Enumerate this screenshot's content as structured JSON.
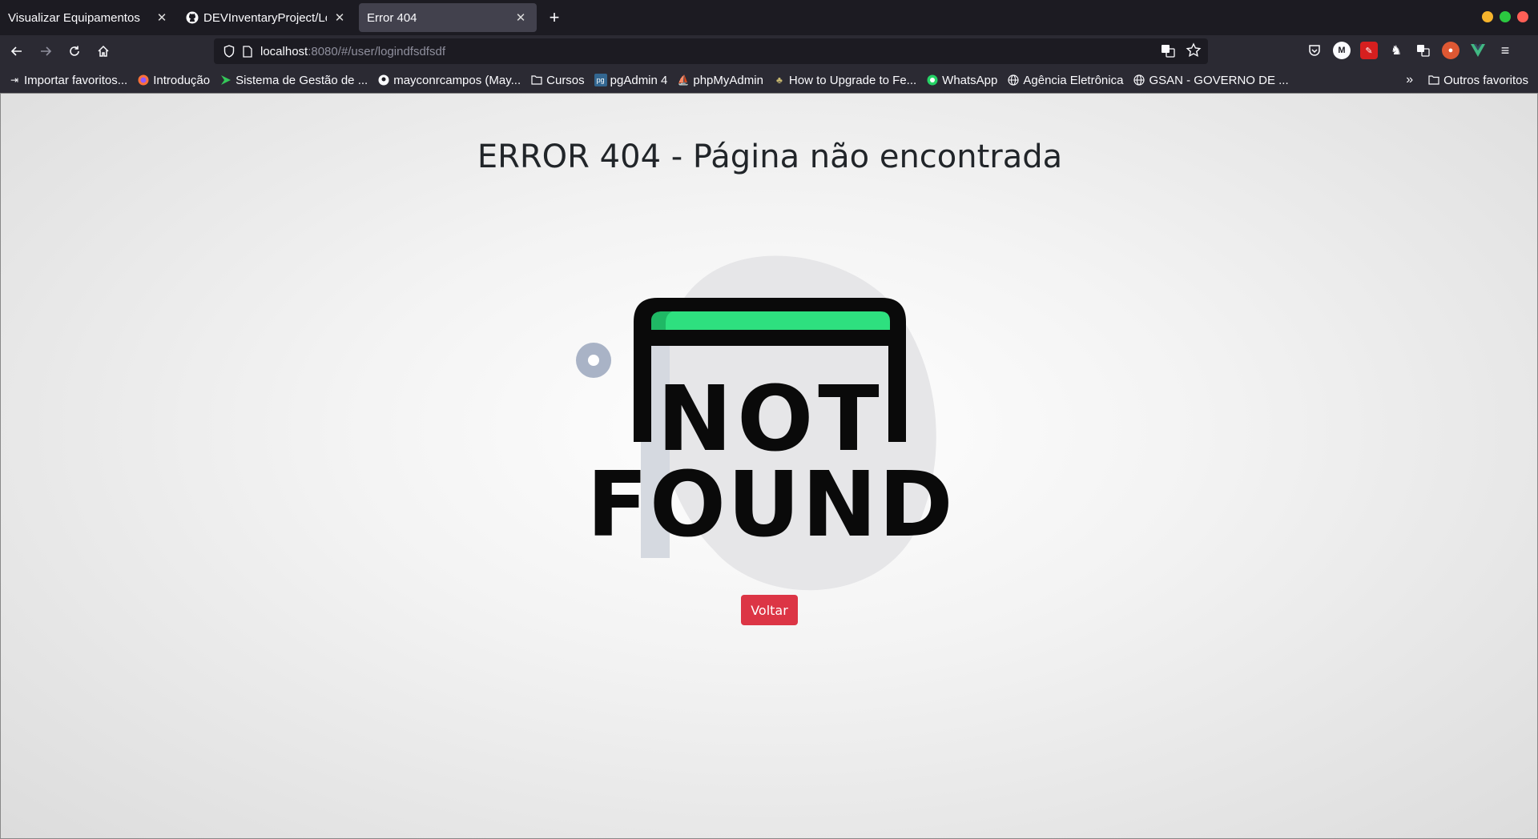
{
  "browser": {
    "tabs": [
      {
        "title": "Visualizar Equipamentos",
        "icon": "none"
      },
      {
        "title": "DEVInventaryProject/Logi",
        "icon": "github-icon"
      },
      {
        "title": "Error 404",
        "icon": "none",
        "active": true
      }
    ],
    "url": {
      "host": "localhost",
      "rest": ":8080/#/user/logindfsdfsdf"
    },
    "bookmarks": [
      {
        "label": "Importar favoritos...",
        "icon": "import-icon"
      },
      {
        "label": "Introdução",
        "icon": "firefox-icon"
      },
      {
        "label": "Sistema de Gestão de ...",
        "icon": "arrow-icon"
      },
      {
        "label": "mayconrcampos (May...",
        "icon": "github-icon"
      },
      {
        "label": "Cursos",
        "icon": "folder-icon"
      },
      {
        "label": "pgAdmin 4",
        "icon": "pgadmin-icon"
      },
      {
        "label": "phpMyAdmin",
        "icon": "phpmyadmin-icon"
      },
      {
        "label": "How to Upgrade to Fe...",
        "icon": "fedora-icon"
      },
      {
        "label": "WhatsApp",
        "icon": "whatsapp-icon"
      },
      {
        "label": "Agência Eletrônica",
        "icon": "globe-icon"
      },
      {
        "label": "GSAN - GOVERNO DE ...",
        "icon": "globe-icon"
      }
    ],
    "other_bookmarks": "Outros favoritos"
  },
  "page": {
    "title": "ERROR 404 - Página não encontrada",
    "illustration_text_line1": "NOT",
    "illustration_text_line2": "FOUND",
    "back_button": "Voltar"
  },
  "colors": {
    "accent_green": "#2ee07f",
    "button_red": "#dc3545",
    "blob_gray": "#e8e8ea",
    "dot_blue": "#a9b3c6"
  }
}
